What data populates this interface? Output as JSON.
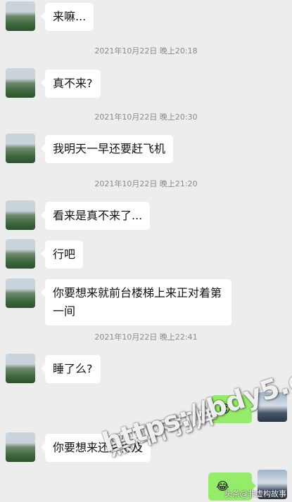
{
  "messages": [
    {
      "text": "来嘛..."
    },
    {
      "text": "真不来?"
    },
    {
      "text": "我明天一早还要赶飞机"
    },
    {
      "text": "看来是真不来了..."
    },
    {
      "text": "行吧"
    },
    {
      "text": "你要想来就前台楼梯上来正对着第一间"
    },
    {
      "text": "睡了么?"
    },
    {
      "text": "你要想来还来得及"
    }
  ],
  "timestamps": [
    "2021年10月22日 晚上20:18",
    "2021年10月22日 晚上20:30",
    "2021年10月22日 晚上21:20",
    "2021年10月22日 晚上22:41"
  ],
  "sent": {
    "emoji_1": "😊",
    "emoji_2": "😂"
  },
  "watermark": {
    "line1": "黑料不打烊",
    "line2": "https://bdy5.co"
  },
  "credit": "头条@非虚构故事",
  "colors": {
    "background": "#ededed",
    "received_bubble": "#ffffff",
    "sent_bubble": "#95ec69",
    "timestamp": "#8a8a8a"
  }
}
